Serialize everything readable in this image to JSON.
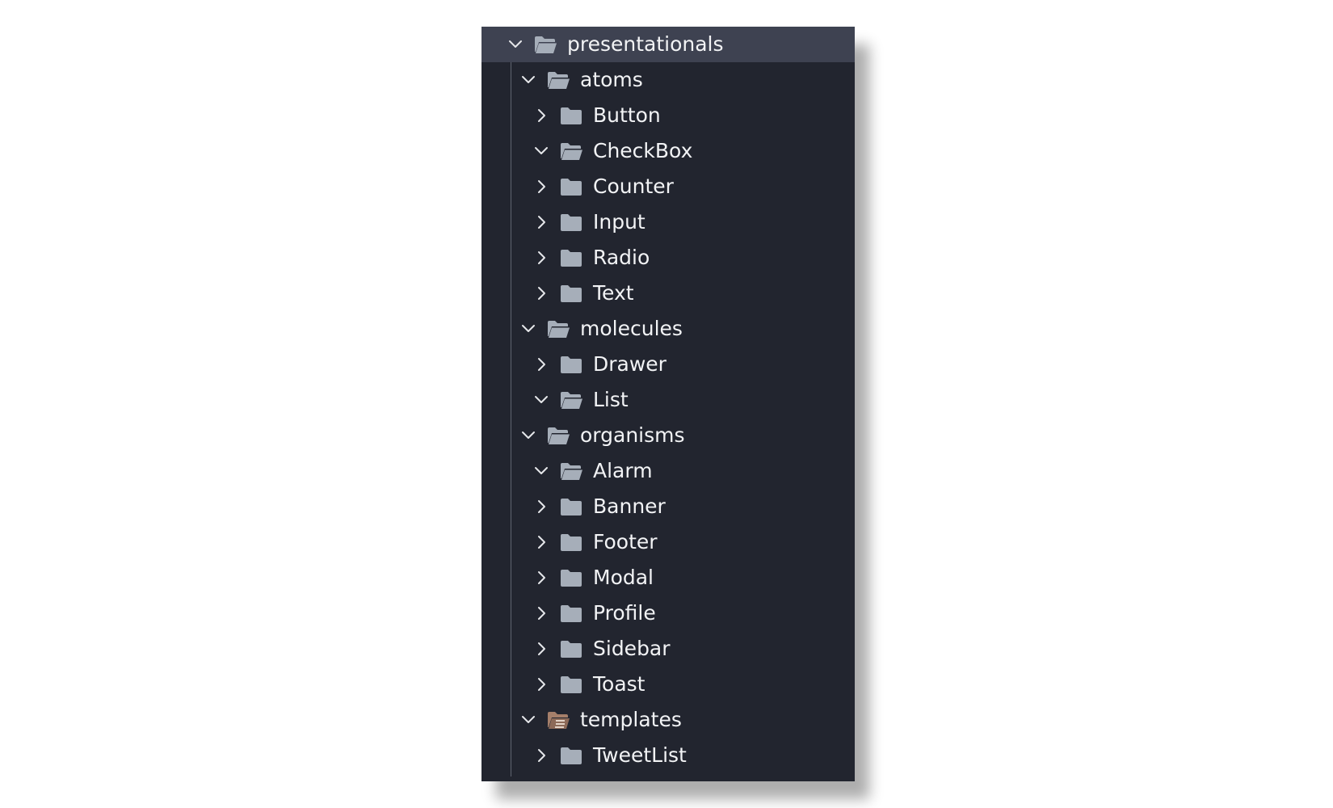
{
  "tree": [
    {
      "label": "presentationals",
      "depth": 0,
      "expanded": true,
      "icon": "folder-open-icon",
      "selected": true
    },
    {
      "label": "atoms",
      "depth": 1,
      "expanded": true,
      "icon": "folder-open-icon"
    },
    {
      "label": "Button",
      "depth": 2,
      "expanded": false,
      "icon": "folder-icon"
    },
    {
      "label": "CheckBox",
      "depth": 2,
      "expanded": true,
      "icon": "folder-open-icon"
    },
    {
      "label": "Counter",
      "depth": 2,
      "expanded": false,
      "icon": "folder-icon"
    },
    {
      "label": "Input",
      "depth": 2,
      "expanded": false,
      "icon": "folder-icon"
    },
    {
      "label": "Radio",
      "depth": 2,
      "expanded": false,
      "icon": "folder-icon"
    },
    {
      "label": "Text",
      "depth": 2,
      "expanded": false,
      "icon": "folder-icon"
    },
    {
      "label": "molecules",
      "depth": 1,
      "expanded": true,
      "icon": "folder-open-icon"
    },
    {
      "label": "Drawer",
      "depth": 2,
      "expanded": false,
      "icon": "folder-icon"
    },
    {
      "label": "List",
      "depth": 2,
      "expanded": true,
      "icon": "folder-open-icon"
    },
    {
      "label": "organisms",
      "depth": 1,
      "expanded": true,
      "icon": "folder-open-icon"
    },
    {
      "label": "Alarm",
      "depth": 2,
      "expanded": true,
      "icon": "folder-open-icon"
    },
    {
      "label": "Banner",
      "depth": 2,
      "expanded": false,
      "icon": "folder-icon"
    },
    {
      "label": "Footer",
      "depth": 2,
      "expanded": false,
      "icon": "folder-icon"
    },
    {
      "label": "Modal",
      "depth": 2,
      "expanded": false,
      "icon": "folder-icon"
    },
    {
      "label": "Profile",
      "depth": 2,
      "expanded": false,
      "icon": "folder-icon"
    },
    {
      "label": "Sidebar",
      "depth": 2,
      "expanded": false,
      "icon": "folder-icon"
    },
    {
      "label": "Toast",
      "depth": 2,
      "expanded": false,
      "icon": "folder-icon"
    },
    {
      "label": "templates",
      "depth": 1,
      "expanded": true,
      "icon": "folder-templates-open-icon"
    },
    {
      "label": "TweetList",
      "depth": 2,
      "expanded": false,
      "icon": "folder-icon"
    }
  ],
  "colors": {
    "panel_bg": "#22252f",
    "selected_bg": "#3e4251",
    "text": "#f2f3f5",
    "folder": "#a6aeb9",
    "chevron": "#e6e7ea",
    "templates_folder": "#a57f6a"
  }
}
